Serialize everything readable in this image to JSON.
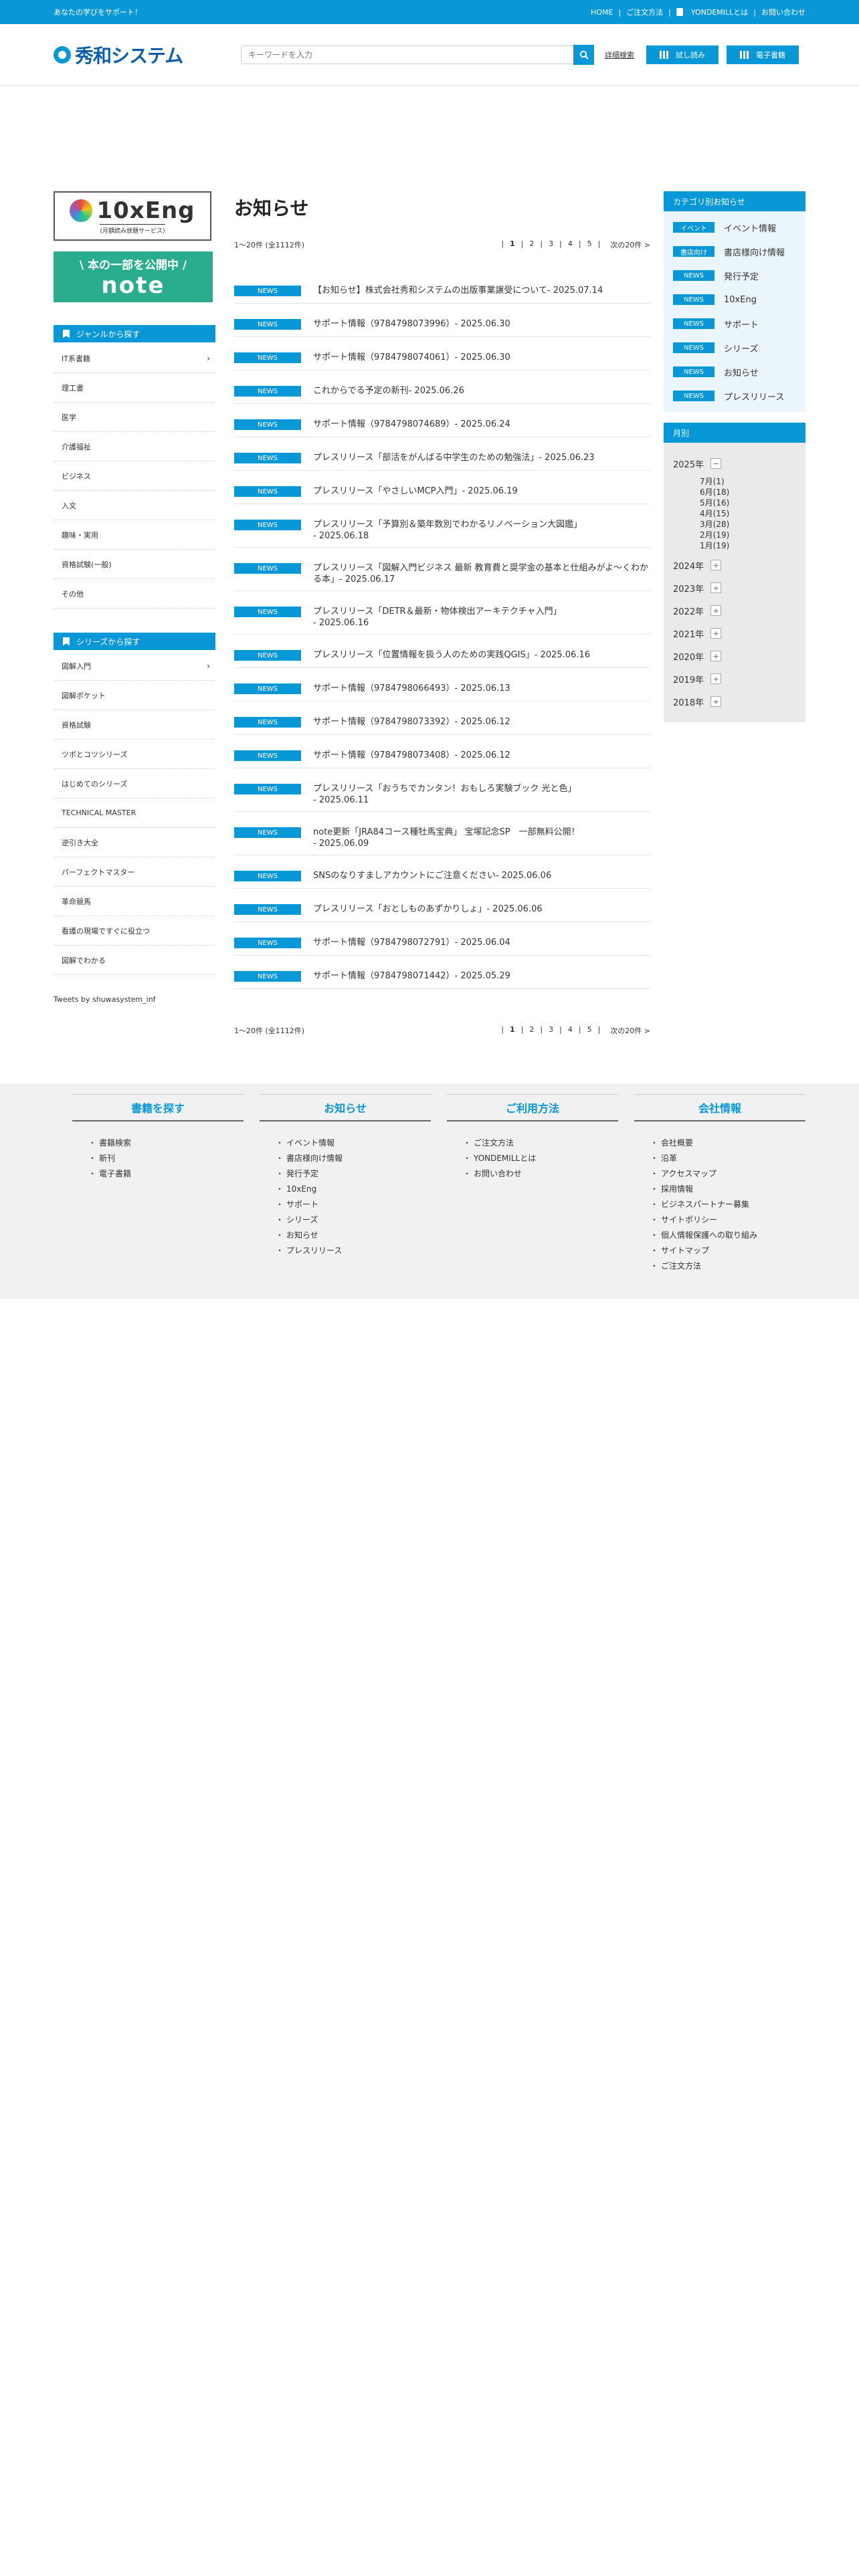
{
  "topbar": {
    "tagline": "あなたの学びをサポート！",
    "links": [
      "HOME",
      "ご注文方法",
      "YONDEMILLとは",
      "お問い合わせ"
    ]
  },
  "header": {
    "logo": "秀和システム",
    "search_placeholder": "キーワードを入力",
    "advanced_search": "詳細検索",
    "trial_button": "試し読み",
    "ebook_button": "電子書籍"
  },
  "left": {
    "banner_10x": {
      "title": "10xEng",
      "subtitle": "(月額読み放題サービス)"
    },
    "banner_note": {
      "line1": "\\ 本の一部を公開中 /",
      "line2": "note"
    },
    "genre_heading": "ジャンルから探す",
    "genres": [
      "IT系書籍",
      "理工書",
      "医学",
      "介護福祉",
      "ビジネス",
      "入文",
      "趣味・実用",
      "資格試験(一般)",
      "その他"
    ],
    "series_heading": "シリーズから探す",
    "series": [
      "図解入門",
      "図解ポケット",
      "資格試験",
      "ツボとコツシリーズ",
      "はじめてのシリーズ",
      "TECHNICAL MASTER",
      "逆引き大全",
      "パーフェクトマスター",
      "革命競馬",
      "看護の現場ですぐに役立つ",
      "図解でわかる"
    ],
    "tweets": "Tweets by shuwasystem_inf"
  },
  "main": {
    "title": "お知らせ",
    "count_text": "1〜20件 (全1112件)",
    "pages": [
      "1",
      "2",
      "3",
      "4",
      "5"
    ],
    "next_text": "次の20件 >",
    "tag": "NEWS",
    "items": [
      "【お知らせ】株式会社秀和システムの出版事業譲受について- 2025.07.14",
      "サポート情報（9784798073996）- 2025.06.30",
      "サポート情報（9784798074061）- 2025.06.30",
      "これからでる予定の新刊- 2025.06.26",
      "サポート情報（9784798074689）- 2025.06.24",
      "プレスリリース「部活をがんばる中学生のための勉強法」- 2025.06.23",
      "プレスリリース「やさしいMCP入門」- 2025.06.19",
      "プレスリリース「予算別＆築年数別でわかるリノベーション大図鑑」\n- 2025.06.18",
      "プレスリリース「図解入門ビジネス 最新 教育費と奨学金の基本と仕組みがよ～くわかる本」- 2025.06.17",
      "プレスリリース「DETR＆最新・物体検出アーキテクチャ入門」\n- 2025.06.16",
      "プレスリリース「位置情報を扱う人のための実践QGIS」- 2025.06.16",
      "サポート情報（9784798066493）- 2025.06.13",
      "サポート情報（9784798073392）- 2025.06.12",
      "サポート情報（9784798073408）- 2025.06.12",
      "プレスリリース「おうちでカンタン！おもしろ実験ブック 光と色」\n- 2025.06.11",
      "note更新「JRA84コース種牡馬宝典」 宝塚記念SP　一部無料公開！\n- 2025.06.09",
      "SNSのなりすましアカウントにご注意ください- 2025.06.06",
      "プレスリリース「おとしものあずかりしょ」- 2025.06.06",
      "サポート情報（9784798072791）- 2025.06.04",
      "サポート情報（9784798071442）- 2025.05.29"
    ]
  },
  "right": {
    "cat_heading": "カテゴリ別お知らせ",
    "categories": [
      {
        "tag": "イベント",
        "label": "イベント情報"
      },
      {
        "tag": "書店向け",
        "label": "書店様向け情報"
      },
      {
        "tag": "NEWS",
        "label": "発行予定"
      },
      {
        "tag": "NEWS",
        "label": "10xEng"
      },
      {
        "tag": "NEWS",
        "label": "サポート"
      },
      {
        "tag": "NEWS",
        "label": "シリーズ"
      },
      {
        "tag": "NEWS",
        "label": "お知らせ"
      },
      {
        "tag": "NEWS",
        "label": "プレスリリース"
      }
    ],
    "month_heading": "月別",
    "year_open": "2025年",
    "months": [
      "7月(1)",
      "6月(18)",
      "5月(16)",
      "4月(15)",
      "3月(28)",
      "2月(19)",
      "1月(19)"
    ],
    "years": [
      "2024年",
      "2023年",
      "2022年",
      "2021年",
      "2020年",
      "2019年",
      "2018年"
    ]
  },
  "footer": {
    "columns": [
      {
        "title": "書籍を探す",
        "items": [
          "書籍検索",
          "新刊",
          "電子書籍"
        ]
      },
      {
        "title": "お知らせ",
        "items": [
          "イベント情報",
          "書店様向け情報",
          "発行予定",
          "10xEng",
          "サポート",
          "シリーズ",
          "お知らせ",
          "プレスリリース"
        ]
      },
      {
        "title": "ご利用方法",
        "items": [
          "ご注文方法",
          "YONDEMILLとは",
          "お問い合わせ"
        ]
      },
      {
        "title": "会社情報",
        "items": [
          "会社概要",
          "沿革",
          "アクセスマップ",
          "採用情報",
          "ビジネスパートナー募集",
          "サイトポリシー",
          "個人情報保護への取り組み",
          "サイトマップ",
          "ご注文方法"
        ]
      }
    ]
  }
}
